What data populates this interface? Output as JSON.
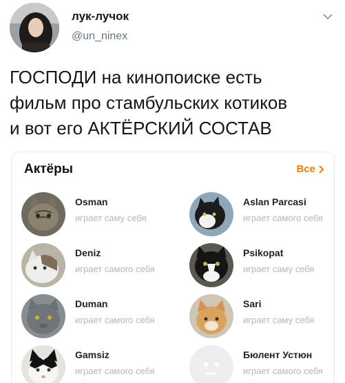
{
  "tweet": {
    "display_name": "лук-лучок",
    "handle": "@un_ninex",
    "text": "ГОСПОДИ на кинопоиске есть\nфильм про стамбульских котиков\nи вот его АКТЁРСКИЙ СОСТАВ",
    "menu_icon": "chevron-down-icon"
  },
  "card": {
    "title": "Актёры",
    "all_label": "Все",
    "accent_color": "#f57a00",
    "actors": [
      {
        "name": "Osman",
        "role": "играет саму себя",
        "photo": "tabby-cat-photo"
      },
      {
        "name": "Aslan Parcasi",
        "role": "играет самого себя",
        "photo": "black-white-cat-photo"
      },
      {
        "name": "Deniz",
        "role": "играет самого себя",
        "photo": "white-tabby-cat-photo"
      },
      {
        "name": "Psikopat",
        "role": "играет саму себя",
        "photo": "tuxedo-cat-photo"
      },
      {
        "name": "Duman",
        "role": "играет самого себя",
        "photo": "grey-cat-photo"
      },
      {
        "name": "Sari",
        "role": "играет саму себя",
        "photo": "ginger-cat-photo"
      },
      {
        "name": "Gamsiz",
        "role": "играет самого себя",
        "photo": "black-white-cat-photo"
      },
      {
        "name": "Бюлент Устюн",
        "role": "играет самого себя",
        "photo": "placeholder-face-icon"
      }
    ]
  }
}
